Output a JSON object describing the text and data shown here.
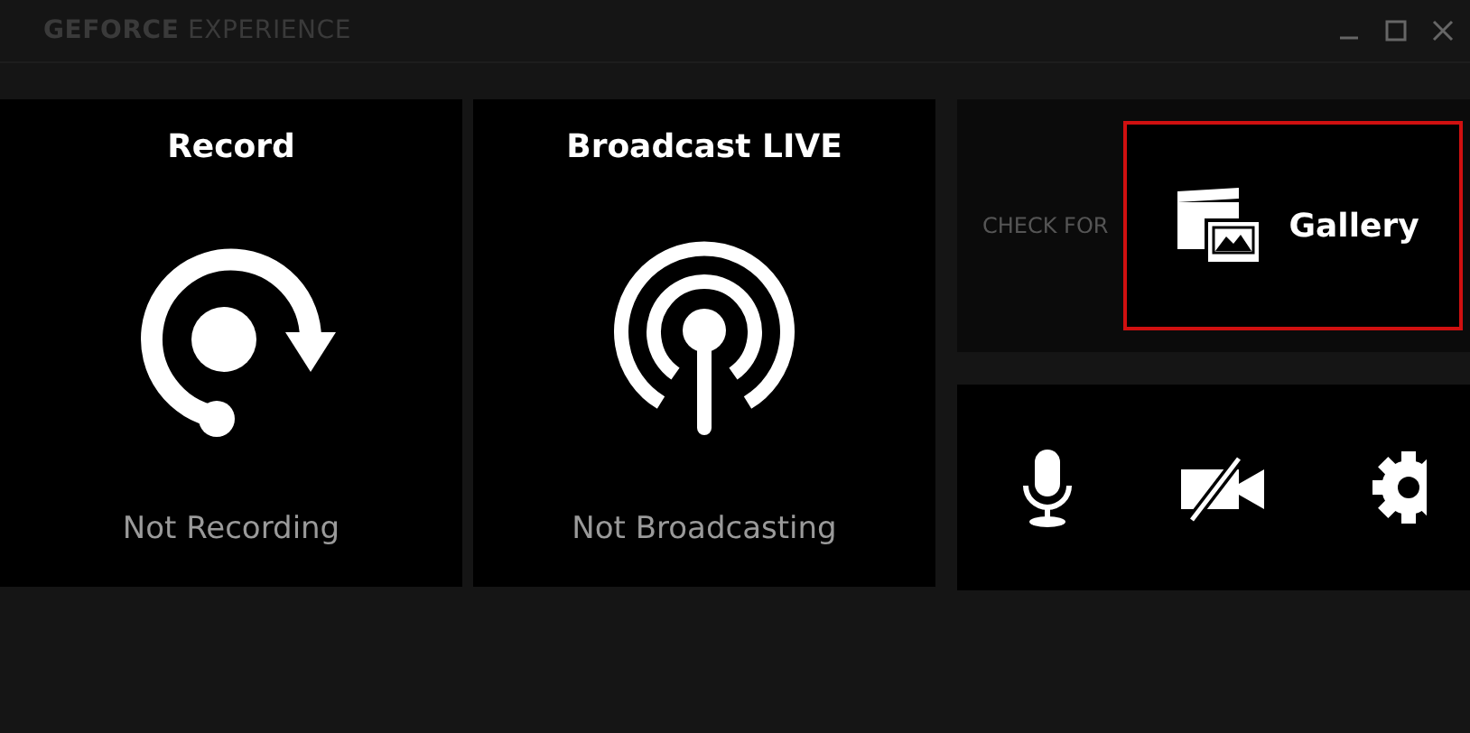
{
  "window": {
    "title_bold": "GEFORCE",
    "title_light": "EXPERIENCE"
  },
  "features": [
    {
      "kind": "record",
      "title": "Record",
      "status": "Not Recording"
    },
    {
      "kind": "broadcast",
      "title": "Broadcast LIVE",
      "status": "Not Broadcasting"
    }
  ],
  "update_hint": "CHECK FOR",
  "gallery": {
    "label": "Gallery",
    "highlighted": true
  },
  "toolbar": [
    {
      "kind": "microphone"
    },
    {
      "kind": "camera-off"
    },
    {
      "kind": "settings"
    }
  ]
}
